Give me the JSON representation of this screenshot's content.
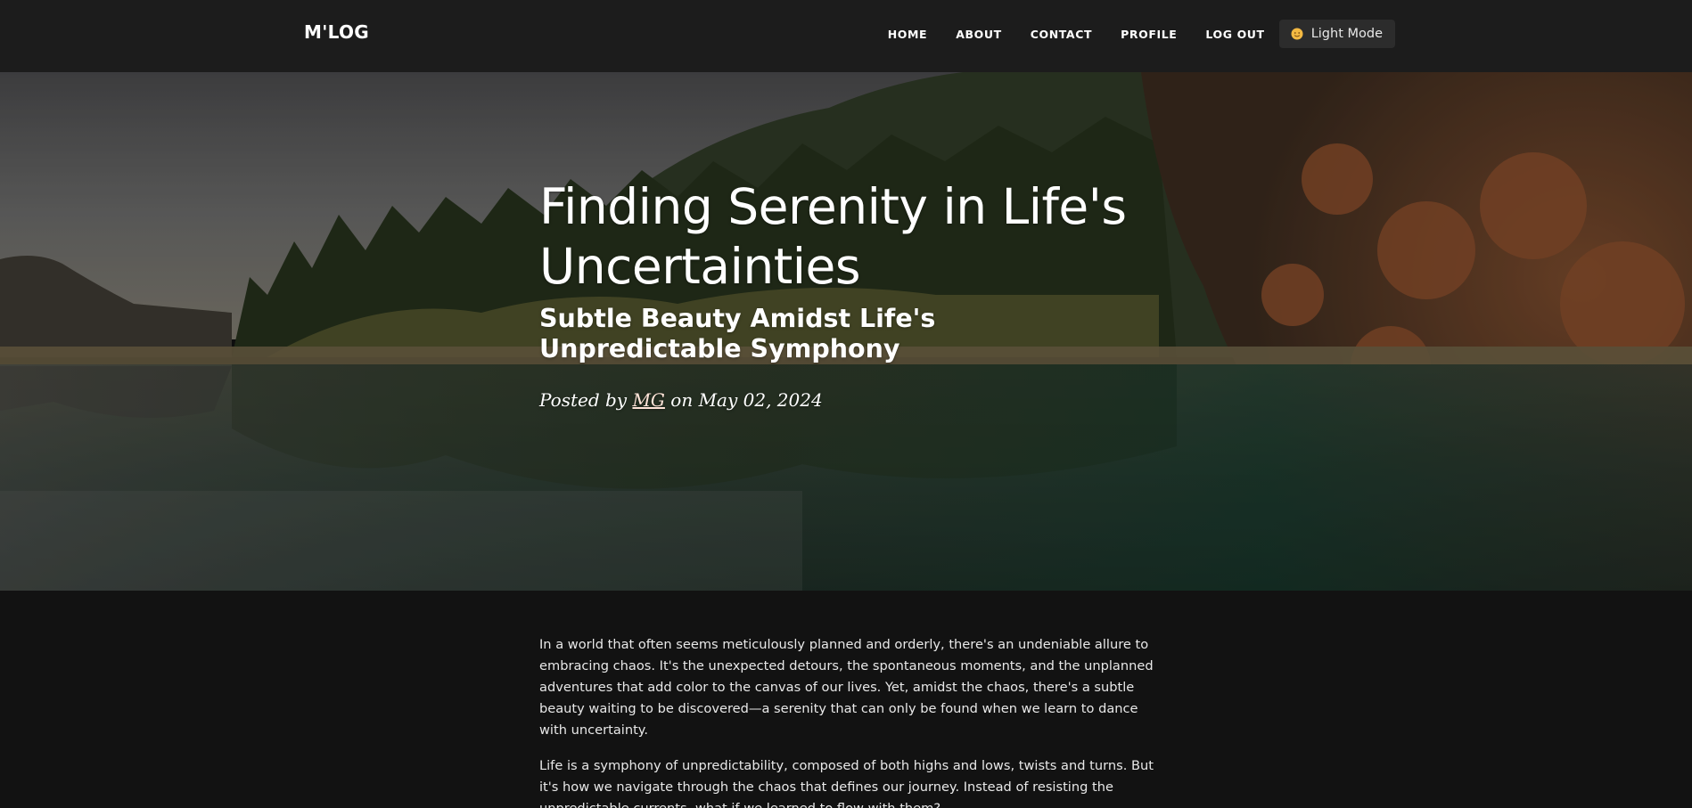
{
  "navbar": {
    "brand": "M'LOG",
    "links": [
      "HOME",
      "ABOUT",
      "CONTACT",
      "PROFILE",
      "LOG OUT"
    ],
    "mode_toggle_label": "Light Mode",
    "mode_toggle_icon": "sun-icon"
  },
  "post": {
    "title": "Finding Serenity in Life's Uncertainties",
    "subtitle": "Subtle Beauty Amidst Life's Unpredictable Symphony",
    "meta_prefix": "Posted by",
    "author": "MG",
    "meta_middle": "on",
    "date": "May 02, 2024",
    "paragraphs": [
      "In a world that often seems meticulously planned and orderly, there's an undeniable allure to embracing chaos. It's the unexpected detours, the spontaneous moments, and the unplanned adventures that add color to the canvas of our lives. Yet, amidst the chaos, there's a subtle beauty waiting to be discovered—a serenity that can only be found when we learn to dance with uncertainty.",
      "Life is a symphony of unpredictability, composed of both highs and lows, twists and turns. But it's how we navigate through the chaos that defines our journey. Instead of resisting the unpredictable currents, what if we learned to flow with them?"
    ]
  },
  "colors": {
    "navbar_bg": "#1c1c1c",
    "page_bg": "#121212",
    "toggle_bg": "#2c2c2c",
    "author_link": "#ffe4d8"
  }
}
